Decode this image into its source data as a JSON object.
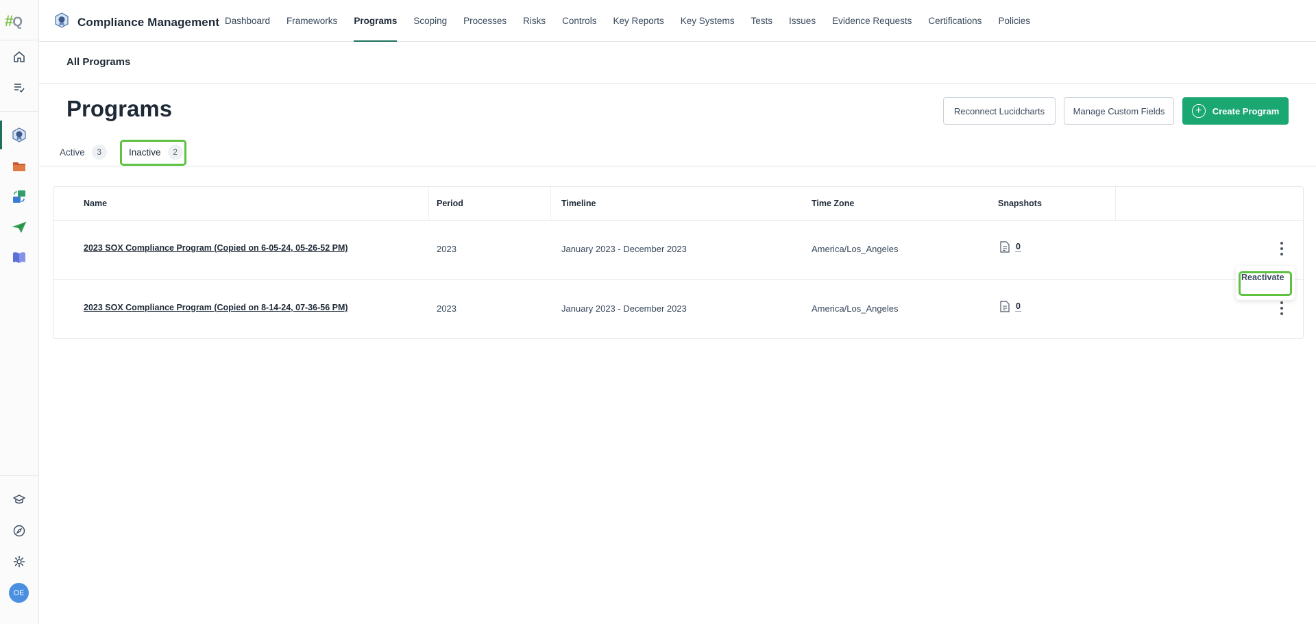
{
  "rail": {
    "logo_hash": "#",
    "logo_letter": "Q",
    "avatar_initials": "OE"
  },
  "app": {
    "title": "Compliance Management"
  },
  "nav": {
    "items": [
      {
        "label": "Dashboard"
      },
      {
        "label": "Frameworks"
      },
      {
        "label": "Programs",
        "active": true
      },
      {
        "label": "Scoping"
      },
      {
        "label": "Processes"
      },
      {
        "label": "Risks"
      },
      {
        "label": "Controls"
      },
      {
        "label": "Key Reports"
      },
      {
        "label": "Key Systems"
      },
      {
        "label": "Tests"
      },
      {
        "label": "Issues"
      },
      {
        "label": "Evidence Requests"
      },
      {
        "label": "Certifications"
      },
      {
        "label": "Policies"
      }
    ]
  },
  "breadcrumb": {
    "label": "All Programs"
  },
  "header": {
    "title": "Programs",
    "buttons": {
      "reconnect": "Reconnect Lucidcharts",
      "custom_fields": "Manage Custom Fields",
      "create": "Create Program"
    }
  },
  "tabs": [
    {
      "label": "Active",
      "count": "3"
    },
    {
      "label": "Inactive",
      "count": "2",
      "selected": true
    }
  ],
  "table": {
    "columns": [
      "Name",
      "Period",
      "Timeline",
      "Time Zone",
      "Snapshots"
    ],
    "rows": [
      {
        "name": "2023 SOX Compliance Program (Copied on 6-05-24, 05-26-52 PM)",
        "period": "2023",
        "timeline": "January 2023 - December 2023",
        "timezone": "America/Los_Angeles",
        "snapshots": "0"
      },
      {
        "name": "2023 SOX Compliance Program (Copied on 8-14-24, 07-36-56 PM)",
        "period": "2023",
        "timeline": "January 2023 - December 2023",
        "timezone": "America/Los_Angeles",
        "snapshots": "0"
      }
    ]
  },
  "row_menu": {
    "reactivate": "Reactivate"
  },
  "colors": {
    "brand_green": "#1aa772",
    "active_underline": "#1f6f5c",
    "highlight": "#5cc23f"
  }
}
